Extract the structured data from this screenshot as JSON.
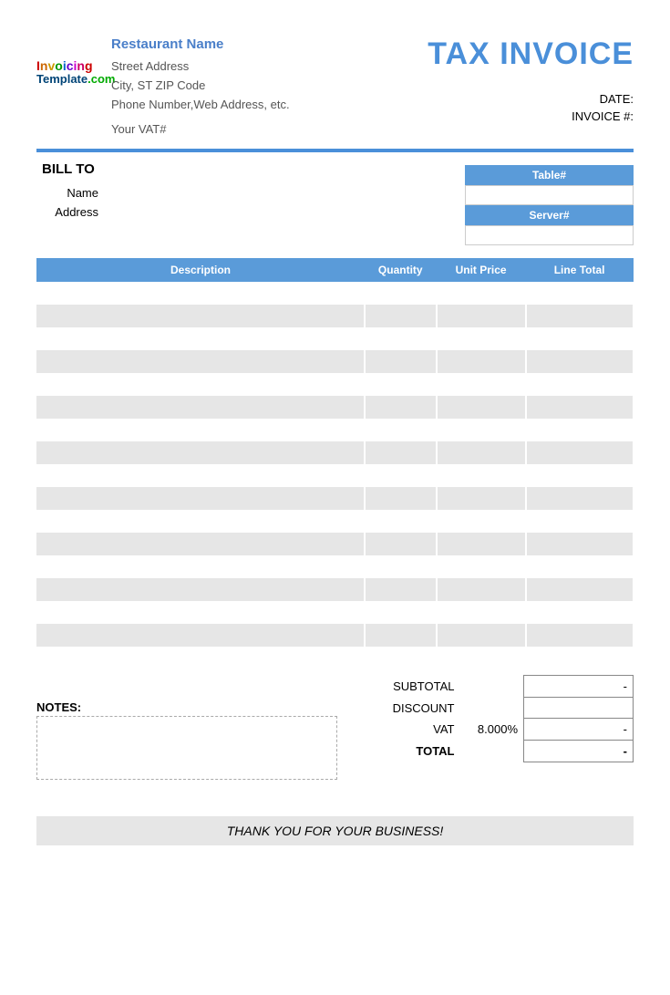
{
  "header": {
    "restaurant_name": "Restaurant Name",
    "logo_line1": "Invoicing",
    "logo_line2": "Template",
    "logo_ext": ".com",
    "address": {
      "street": "Street Address",
      "city": "City, ST  ZIP Code",
      "phone": "Phone Number,Web Address, etc.",
      "vat": "Your VAT#"
    },
    "title": "TAX INVOICE",
    "date_label": "DATE:",
    "invoice_label": "INVOICE #:"
  },
  "billto": {
    "title": "BILL TO",
    "name_label": "Name",
    "address_label": "Address"
  },
  "table_server": {
    "table_label": "Table#",
    "server_label": "Server#"
  },
  "columns": {
    "desc": "Description",
    "qty": "Quantity",
    "unit": "Unit Price",
    "line": "Line Total"
  },
  "totals": {
    "subtotal_label": "SUBTOTAL",
    "discount_label": "DISCOUNT",
    "vat_label": "VAT",
    "vat_value": "8.000%",
    "total_label": "TOTAL",
    "dash": "-"
  },
  "notes_label": "NOTES:",
  "thanks": "THANK YOU FOR YOUR BUSINESS!"
}
